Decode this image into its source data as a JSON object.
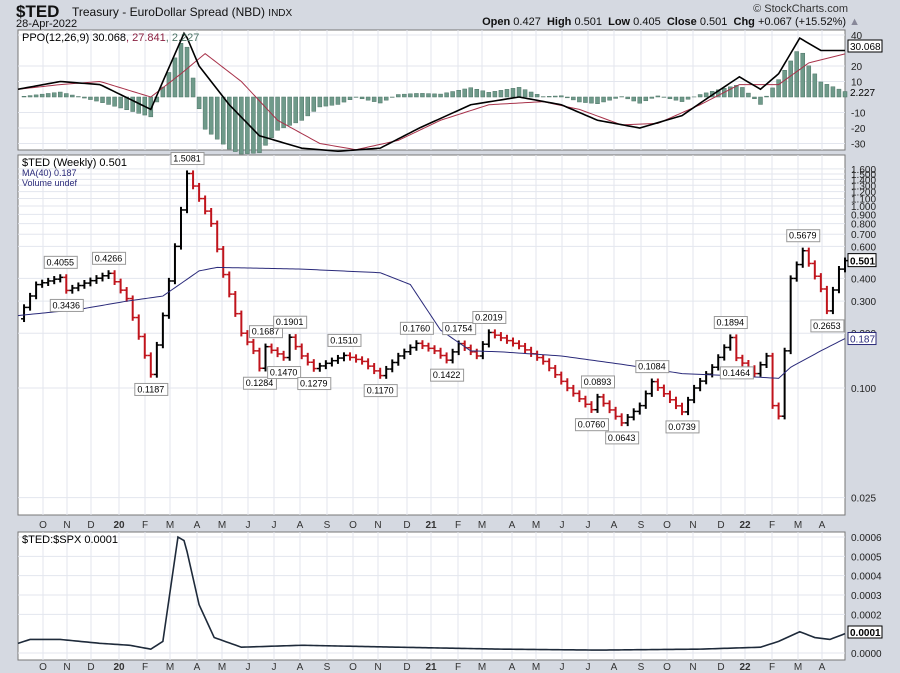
{
  "header": {
    "symbol": "$TED",
    "name": "Treasury - EuroDollar Spread (NBD)",
    "exchange": "INDX",
    "date": "28-Apr-2022",
    "brand": "© StockCharts.com",
    "open_label": "Open",
    "open": "0.427",
    "high_label": "High",
    "high": "0.501",
    "low_label": "Low",
    "low": "0.405",
    "close_label": "Close",
    "close": "0.501",
    "chg_label": "Chg",
    "chg": "+0.067 (+15.52%)"
  },
  "chart_data": [
    {
      "type": "line",
      "title": "PPO(12,26,9) 30.068, 27.841, 2.227",
      "legend": {
        "ppo": "PPO(12,26,9) 30.068",
        "signal": "27.841",
        "hist": "2.227"
      },
      "ylim": [
        -36,
        42
      ],
      "yticks": [
        40,
        20,
        10,
        -10,
        -20,
        -30
      ],
      "last_labels": [
        "30.068",
        "2.227"
      ],
      "ppo": [
        [
          0,
          5
        ],
        [
          7,
          10
        ],
        [
          13.6,
          8
        ],
        [
          22,
          -8
        ],
        [
          24,
          10
        ],
        [
          27.6,
          42
        ],
        [
          30,
          20
        ],
        [
          35,
          -5
        ],
        [
          40,
          -25
        ],
        [
          47,
          -33
        ],
        [
          53,
          -35
        ],
        [
          60,
          -33
        ],
        [
          66.5,
          -20
        ],
        [
          75,
          -5
        ],
        [
          83,
          0
        ],
        [
          90,
          -5
        ],
        [
          96,
          -15
        ],
        [
          103,
          -20
        ],
        [
          110,
          -12
        ],
        [
          114.5,
          0
        ],
        [
          119.5,
          13
        ],
        [
          123,
          5
        ],
        [
          126,
          15
        ],
        [
          129.5,
          38
        ],
        [
          133,
          30
        ],
        [
          137,
          30
        ]
      ],
      "signal": [
        [
          0,
          5
        ],
        [
          7,
          8
        ],
        [
          13.6,
          10
        ],
        [
          22,
          0
        ],
        [
          27,
          15
        ],
        [
          31,
          28
        ],
        [
          37,
          10
        ],
        [
          43,
          -15
        ],
        [
          50,
          -30
        ],
        [
          56,
          -34
        ],
        [
          63,
          -28
        ],
        [
          70,
          -15
        ],
        [
          78,
          -5
        ],
        [
          87,
          -3
        ],
        [
          93,
          -8
        ],
        [
          100,
          -18
        ],
        [
          106,
          -17
        ],
        [
          113,
          -5
        ],
        [
          119.5,
          8
        ],
        [
          126,
          8
        ],
        [
          131,
          22
        ],
        [
          137,
          27.8
        ]
      ]
    },
    {
      "type": "ohlc",
      "title": "$TED (Weekly) 0.501",
      "legend": [
        "$TED (Weekly) 0.501",
        "MA(40) 0.187",
        "Volume undef"
      ],
      "yscale": "log",
      "ylim": [
        0.022,
        1.75
      ],
      "yticks": [
        "1.600",
        "1.500",
        "1.400",
        "1.300",
        "1.200",
        "1.100",
        "1.000",
        "0.900",
        "0.800",
        "0.700",
        "0.600",
        "0.400",
        "0.300",
        "0.200",
        "0.100",
        "0.025"
      ],
      "last_labels": [
        "0.501",
        "0.187"
      ],
      "close": [
        [
          0,
          0.24
        ],
        [
          3,
          0.37
        ],
        [
          7,
          0.4055
        ],
        [
          8,
          0.3436
        ],
        [
          15,
          0.4266
        ],
        [
          18,
          0.31
        ],
        [
          22,
          0.1187
        ],
        [
          24,
          0.25
        ],
        [
          26,
          0.6
        ],
        [
          28,
          1.5081
        ],
        [
          32,
          0.8
        ],
        [
          34,
          0.42
        ],
        [
          37,
          0.2
        ],
        [
          39,
          0.16
        ],
        [
          40,
          0.1284
        ],
        [
          41,
          0.1687
        ],
        [
          44,
          0.147
        ],
        [
          45,
          0.1901
        ],
        [
          47,
          0.15
        ],
        [
          49,
          0.1279
        ],
        [
          54,
          0.151
        ],
        [
          57,
          0.14
        ],
        [
          60,
          0.117
        ],
        [
          63,
          0.15
        ],
        [
          66,
          0.176
        ],
        [
          69,
          0.16
        ],
        [
          71,
          0.1422
        ],
        [
          73,
          0.1754
        ],
        [
          76,
          0.15
        ],
        [
          78,
          0.2019
        ],
        [
          83,
          0.17
        ],
        [
          87,
          0.14
        ],
        [
          91,
          0.1
        ],
        [
          95,
          0.076
        ],
        [
          96,
          0.0893
        ],
        [
          100,
          0.0643
        ],
        [
          103,
          0.08
        ],
        [
          105,
          0.1084
        ],
        [
          110,
          0.0739
        ],
        [
          112,
          0.1
        ],
        [
          115,
          0.13
        ],
        [
          118,
          0.1894
        ],
        [
          119,
          0.1464
        ],
        [
          122,
          0.12
        ],
        [
          124,
          0.15
        ],
        [
          125,
          0.08
        ],
        [
          126,
          0.07
        ],
        [
          127,
          0.16
        ],
        [
          128,
          0.4
        ],
        [
          130,
          0.5679
        ],
        [
          133,
          0.35
        ],
        [
          134,
          0.2653
        ],
        [
          136,
          0.45
        ],
        [
          137,
          0.501
        ]
      ],
      "ma40": [
        [
          0,
          0.25
        ],
        [
          10,
          0.27
        ],
        [
          18,
          0.3
        ],
        [
          24,
          0.32
        ],
        [
          30,
          0.44
        ],
        [
          33,
          0.46
        ],
        [
          47,
          0.45
        ],
        [
          60,
          0.43
        ],
        [
          65,
          0.37
        ],
        [
          70,
          0.208
        ],
        [
          75,
          0.16
        ],
        [
          80,
          0.158
        ],
        [
          90,
          0.15
        ],
        [
          100,
          0.135
        ],
        [
          110,
          0.12
        ],
        [
          118,
          0.117
        ],
        [
          126,
          0.113
        ],
        [
          128,
          0.13
        ],
        [
          133,
          0.16
        ],
        [
          137,
          0.187
        ]
      ],
      "annotations": [
        [
          7,
          "0.4055"
        ],
        [
          8,
          "0.3436"
        ],
        [
          15,
          "0.4266"
        ],
        [
          22,
          "0.1187"
        ],
        [
          28,
          "1.5081"
        ],
        [
          40,
          "0.1284"
        ],
        [
          41,
          "0.1687"
        ],
        [
          44,
          "0.1470"
        ],
        [
          45,
          "0.1901"
        ],
        [
          49,
          "0.1279"
        ],
        [
          54,
          "0.1510"
        ],
        [
          60,
          "0.1170"
        ],
        [
          66,
          "0.1760"
        ],
        [
          71,
          "0.1422"
        ],
        [
          73,
          "0.1754"
        ],
        [
          78,
          "0.2019"
        ],
        [
          95,
          "0.0760"
        ],
        [
          96,
          "0.0893"
        ],
        [
          100,
          "0.0643"
        ],
        [
          105,
          "0.1084"
        ],
        [
          110,
          "0.0739"
        ],
        [
          118,
          "0.1894"
        ],
        [
          119,
          "0.1464"
        ],
        [
          130,
          "0.5679"
        ],
        [
          134,
          "0.2653"
        ]
      ]
    },
    {
      "type": "line",
      "title": "$TED:$SPX 0.0001",
      "ylim": [
        0,
        0.00062
      ],
      "yticks": [
        "0.0006",
        "0.0005",
        "0.0004",
        "0.0003",
        "0.0002",
        "0.0000"
      ],
      "last_label": "0.0001",
      "values": [
        [
          0,
          5e-05
        ],
        [
          2,
          7e-05
        ],
        [
          7,
          7e-05
        ],
        [
          13.6,
          5e-05
        ],
        [
          18.5,
          4e-05
        ],
        [
          22,
          2e-05
        ],
        [
          24,
          6e-05
        ],
        [
          26.5,
          0.0006
        ],
        [
          27.6,
          0.00058
        ],
        [
          30,
          0.00025
        ],
        [
          32.5,
          8e-05
        ],
        [
          37,
          3e-05
        ],
        [
          47,
          4e-05
        ],
        [
          63,
          3e-05
        ],
        [
          80,
          2e-05
        ],
        [
          96,
          1.5e-05
        ],
        [
          113,
          2e-05
        ],
        [
          123,
          3e-05
        ],
        [
          126,
          6e-05
        ],
        [
          129.5,
          0.00011
        ],
        [
          132,
          8e-05
        ],
        [
          134.5,
          7e-05
        ],
        [
          137,
          0.0001
        ]
      ]
    },
    {
      "type": "axis",
      "xticks": [
        "O",
        "N",
        "D",
        "20",
        "F",
        "M",
        "A",
        "M",
        "J",
        "J",
        "A",
        "S",
        "O",
        "N",
        "D",
        "21",
        "F",
        "M",
        "A",
        "M",
        "J",
        "J",
        "A",
        "S",
        "O",
        "N",
        "D",
        "22",
        "F",
        "M",
        "A"
      ]
    }
  ]
}
